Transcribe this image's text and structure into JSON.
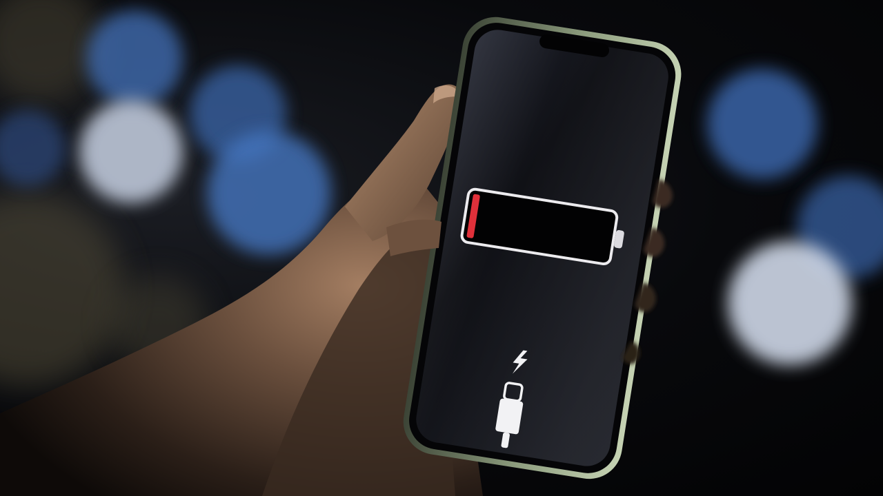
{
  "scene": {
    "subject": "hand-holding-smartphone-low-battery",
    "battery_level_fraction": 0.03,
    "charging": true
  },
  "colors": {
    "background": "#050608",
    "bokeh_blue": "#3d6fb5",
    "bokeh_white": "#c9d3e3",
    "bokeh_warm": "#6b6244",
    "phone_frame": "#a8b896",
    "screen": "#0a0b0f",
    "battery_outline": "#e9e9ec",
    "battery_low": "#e0303a",
    "skin_light": "#8a6b55",
    "skin_dark": "#2a1d16"
  },
  "icons": {
    "battery": "battery-empty-icon",
    "bolt": "lightning-bolt-icon",
    "connector": "lightning-connector-icon"
  }
}
